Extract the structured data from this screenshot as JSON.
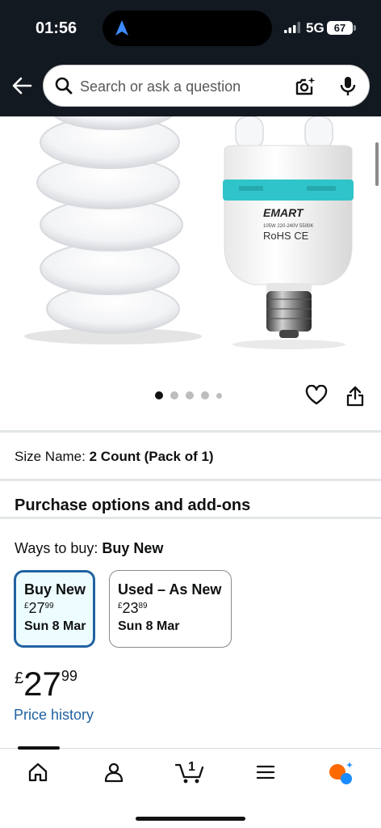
{
  "status_bar": {
    "time": "01:56",
    "network": "5G",
    "battery": "67"
  },
  "search": {
    "placeholder": "Search or ask a question"
  },
  "product_image": {
    "brand_text": "EMART",
    "spec_text": "105W 220-240V 5500K",
    "cert_text": "RoHS  CE",
    "carousel_count": 5,
    "carousel_active": 0
  },
  "size": {
    "label": "Size Name:",
    "value": "2 Count (Pack of 1)"
  },
  "purchase": {
    "section_title": "Purchase options and add-ons",
    "ways_label": "Ways to buy:",
    "ways_value": "Buy New",
    "options": [
      {
        "title": "Buy New",
        "currency": "£",
        "whole": "27",
        "fraction": "99",
        "date": "Sun 8 Mar",
        "selected": true
      },
      {
        "title": "Used – As New",
        "currency": "£",
        "whole": "23",
        "fraction": "89",
        "date": "Sun 8 Mar",
        "selected": false
      }
    ]
  },
  "price": {
    "currency": "£",
    "whole": "27",
    "fraction": "99",
    "history_link": "Price history"
  },
  "nav": {
    "items": [
      "home-icon",
      "account-icon",
      "cart-icon",
      "menu-icon",
      "rufus-icon"
    ],
    "cart_count": "1"
  },
  "colors": {
    "header_bg": "#131921",
    "accent_blue": "#2162a1",
    "selected_bg": "#edfdff",
    "bulb_band": "#2fc4c9",
    "rufus_orange": "#ff6a00",
    "rufus_blue": "#1a8cff"
  }
}
